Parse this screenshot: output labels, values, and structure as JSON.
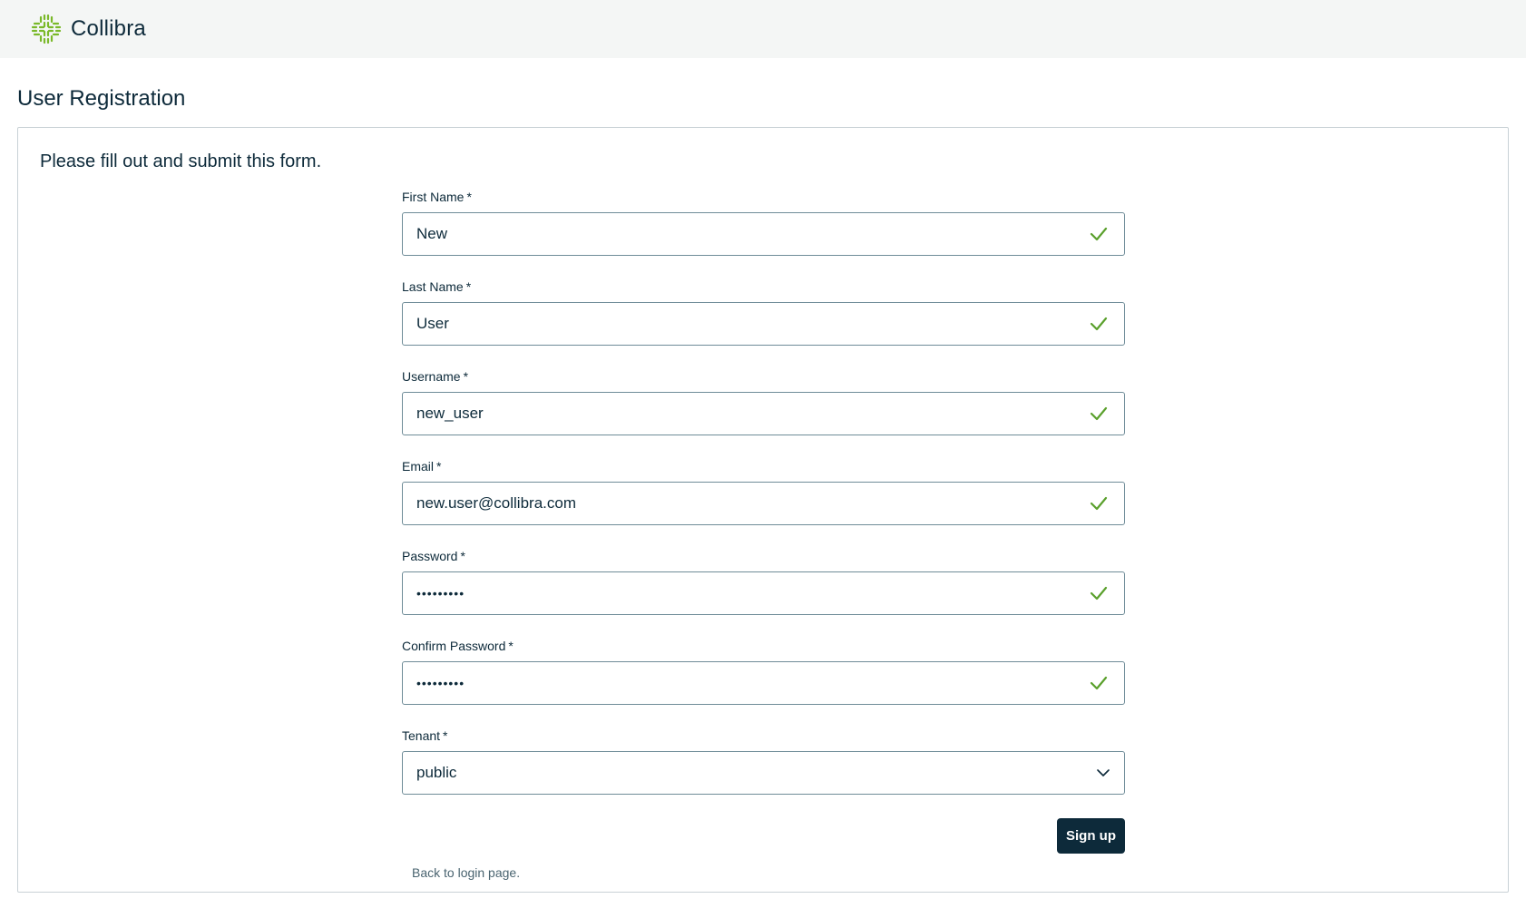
{
  "brand": {
    "name": "Collibra",
    "logo_icon": "collibra-logo-icon",
    "accent_color": "#7ab929"
  },
  "page": {
    "title": "User Registration",
    "intro": "Please fill out and submit this form."
  },
  "form": {
    "required_marker": "*",
    "fields": [
      {
        "label": "First Name",
        "value": "New",
        "valid": true
      },
      {
        "label": "Last Name",
        "value": "User",
        "valid": true
      },
      {
        "label": "Username",
        "value": "new_user",
        "valid": true
      },
      {
        "label": "Email",
        "value": "new.user@collibra.com",
        "valid": true
      },
      {
        "label": "Password",
        "value": "•••••••••",
        "valid": true
      },
      {
        "label": "Confirm Password",
        "value": "•••••••••",
        "valid": true
      }
    ],
    "tenant": {
      "label": "Tenant",
      "value": "public"
    },
    "submit_label": "Sign up",
    "back_link": "Back to login page."
  },
  "colors": {
    "primary": "#0d2a3a",
    "valid": "#5aa02c",
    "topbar_bg": "#f4f6f5"
  }
}
